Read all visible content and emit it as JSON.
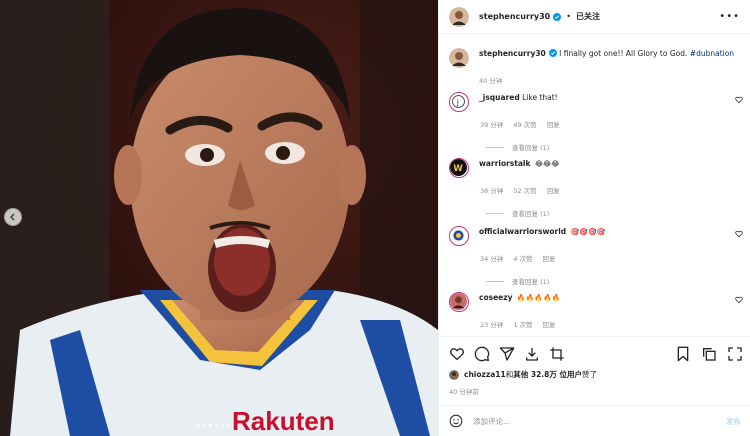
{
  "post": {
    "author": "stephencurry30",
    "follow_label": "已关注",
    "separator": "•",
    "caption_text": " I finally got one!! All Glory to God. ",
    "hashtag": "#dubnation",
    "caption_time": "40 分钟",
    "jersey_text": "Rakuten"
  },
  "comments": [
    {
      "user": "_jsquared",
      "text": " Like that!",
      "time": "39 分钟",
      "likes": "49 次赞",
      "reply": "回复",
      "view_replies": "查看回复 (1)",
      "avatar_color": "#ffffff"
    },
    {
      "user": "warriorstalk",
      "text": " ",
      "emojis": "😂😂😂",
      "time": "38 分钟",
      "likes": "52 次赞",
      "reply": "回复",
      "view_replies": "查看回复 (1)",
      "avatar_color": "#111111"
    },
    {
      "user": "officialwarriorsworld",
      "text": " ",
      "emojis": "🎯🎯🎯🎯",
      "time": "34 分钟",
      "likes": "4 次赞",
      "reply": "回复",
      "view_replies": "查看回复 (1)",
      "avatar_color": "#ffffff"
    },
    {
      "user": "coseezy",
      "text": " ",
      "emojis": "🔥🔥🔥🔥🔥",
      "time": "23 分钟",
      "likes": "1 次赞",
      "reply": "回复",
      "avatar_color": "#c86a6a"
    }
  ],
  "liked_by": {
    "user": "chiozza11",
    "conj": " 和 ",
    "others": "其他 32.8万 位用户",
    "suffix": " 赞了"
  },
  "post_time": "40 分钟前",
  "add_comment": {
    "placeholder": "添加评论...",
    "post_label": "发布"
  },
  "colors": {
    "link": "#00376b",
    "muted": "#8e8e8e",
    "post_disabled": "#b2dffc",
    "verified": "#0095f6"
  },
  "icons": [
    "heart-icon",
    "comment-icon",
    "share-icon",
    "download-icon",
    "crop-icon",
    "bookmark-icon",
    "copy-icon",
    "fullscreen-icon",
    "emoji-icon",
    "more-icon",
    "verified-icon",
    "chevron-left-icon"
  ]
}
